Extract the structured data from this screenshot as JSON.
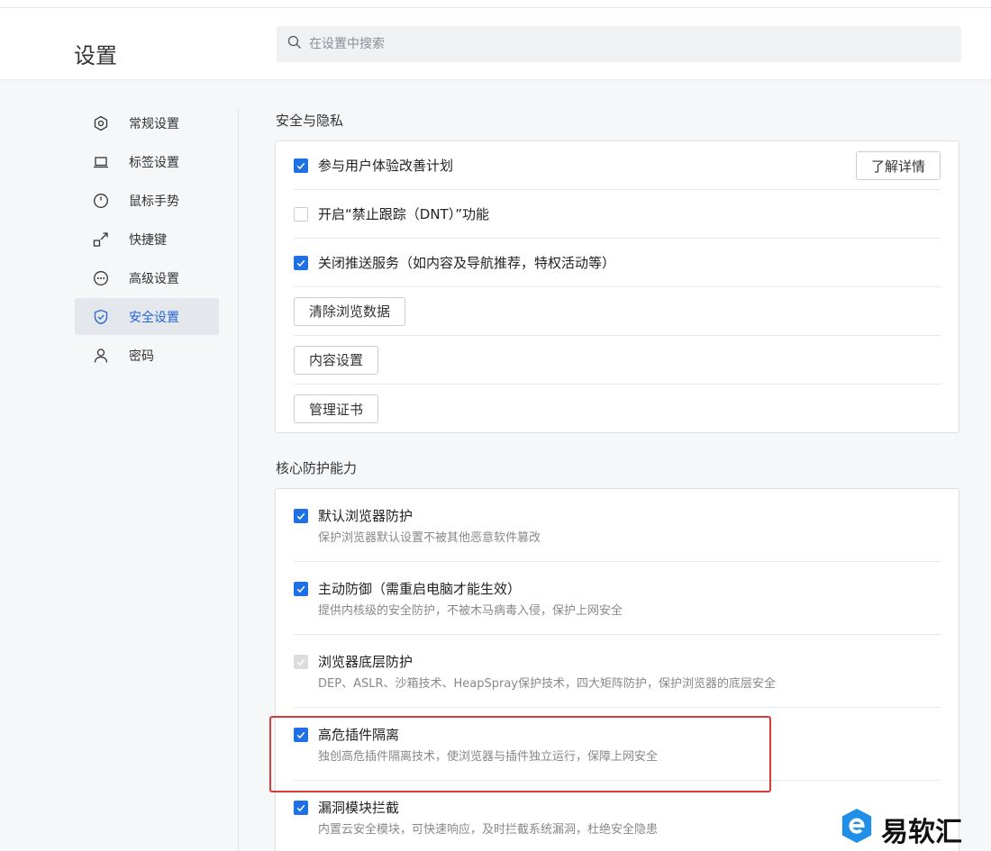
{
  "header": {
    "title": "设置",
    "search_placeholder": "在设置中搜索"
  },
  "sidebar": {
    "items": [
      {
        "label": "常规设置",
        "icon": "gear-icon",
        "active": false
      },
      {
        "label": "标签设置",
        "icon": "laptop-icon",
        "active": false
      },
      {
        "label": "鼠标手势",
        "icon": "mouse-icon",
        "active": false
      },
      {
        "label": "快捷键",
        "icon": "shortcut-arrow-icon",
        "active": false
      },
      {
        "label": "高级设置",
        "icon": "more-dots-icon",
        "active": false
      },
      {
        "label": "安全设置",
        "icon": "shield-icon",
        "active": true
      },
      {
        "label": "密码",
        "icon": "user-icon",
        "active": false
      }
    ]
  },
  "privacy": {
    "title": "安全与隐私",
    "improve_label": "参与用户体验改善计划",
    "learn_more": "了解详情",
    "dnt_label": "开启“禁止跟踪（DNT）”功能",
    "push_label": "关闭推送服务（如内容及导航推荐，特权活动等）",
    "clear_data": "清除浏览数据",
    "content_settings": "内容设置",
    "manage_certs": "管理证书"
  },
  "protection": {
    "title": "核心防护能力",
    "items": [
      {
        "label": "默认浏览器防护",
        "desc": "保护浏览器默认设置不被其他恶意软件篡改",
        "state": "on"
      },
      {
        "label": "主动防御（需重启电脑才能生效）",
        "desc": "提供内核级的安全防护，不被木马病毒入侵，保护上网安全",
        "state": "on"
      },
      {
        "label": "浏览器底层防护",
        "desc": "DEP、ASLR、沙箱技术、HeapSpray保护技术，四大矩阵防护，保护浏览器的底层安全",
        "state": "disabled"
      },
      {
        "label": "高危插件隔离",
        "desc": "独创高危插件隔离技术，使浏览器与插件独立运行，保障上网安全",
        "state": "on"
      },
      {
        "label": "漏洞模块拦截",
        "desc": "内置云安全模块，可快速响应，及时拦截系统漏洞，杜绝安全隐患",
        "state": "on"
      }
    ]
  },
  "watermark": {
    "text": "易软汇"
  },
  "colors": {
    "accent": "#1f6fe5",
    "highlight": "#d93a3a",
    "active_bg": "#e4e7ec"
  }
}
